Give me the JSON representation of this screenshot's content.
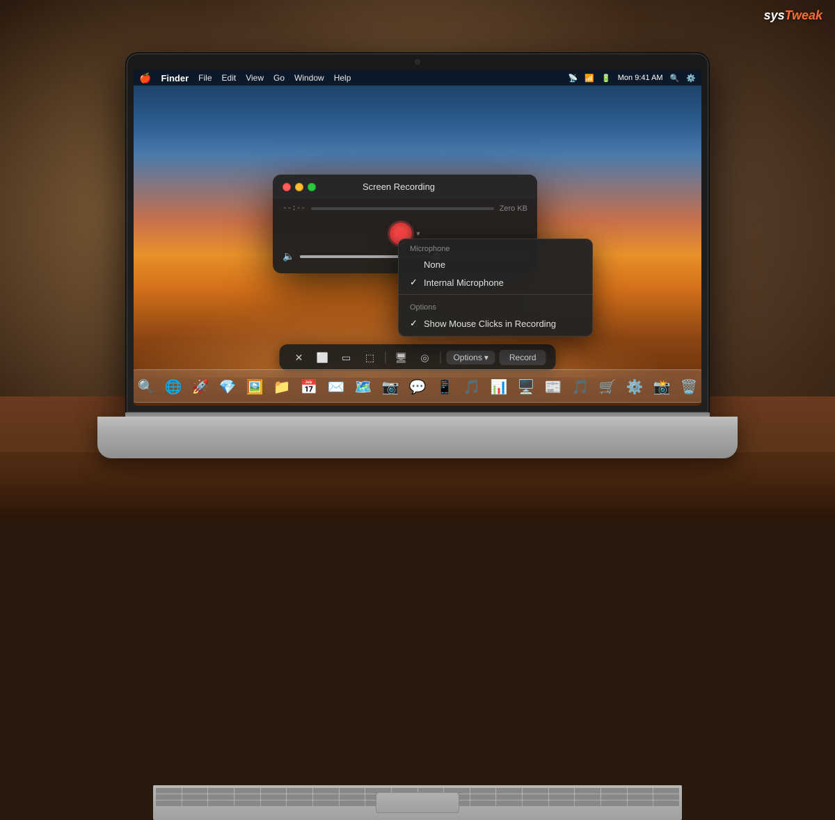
{
  "watermark": {
    "prefix": "sys",
    "suffix": "Tweak"
  },
  "menubar": {
    "apple": "🍎",
    "app": "Finder",
    "items": [
      "File",
      "Edit",
      "View",
      "Go",
      "Window",
      "Help"
    ],
    "time": "Mon 9:41 AM"
  },
  "recording_window": {
    "title": "Screen Recording",
    "time": "--:--",
    "file_size": "Zero KB",
    "traffic_lights": {
      "red_label": "close",
      "yellow_label": "minimize",
      "green_label": "maximize"
    }
  },
  "dropdown_menu": {
    "microphone_header": "Microphone",
    "items_microphone": [
      {
        "label": "None",
        "checked": false
      },
      {
        "label": "Internal Microphone",
        "checked": true
      }
    ],
    "options_header": "Options",
    "items_options": [
      {
        "label": "Show Mouse Clicks in Recording",
        "checked": true
      }
    ]
  },
  "toolbar": {
    "options_label": "Options",
    "record_label": "Record",
    "chevron": "▾"
  },
  "dock": {
    "items": [
      "🔍",
      "🌐",
      "🚀",
      "💎",
      "🖼️",
      "📁",
      "📅",
      "✉️",
      "🗺️",
      "🖼️",
      "💬",
      "📱",
      "🎵",
      "📊",
      "🖥️",
      "📰",
      "🎵",
      "🛒",
      "⚙️",
      "📷",
      "🗑️"
    ]
  }
}
